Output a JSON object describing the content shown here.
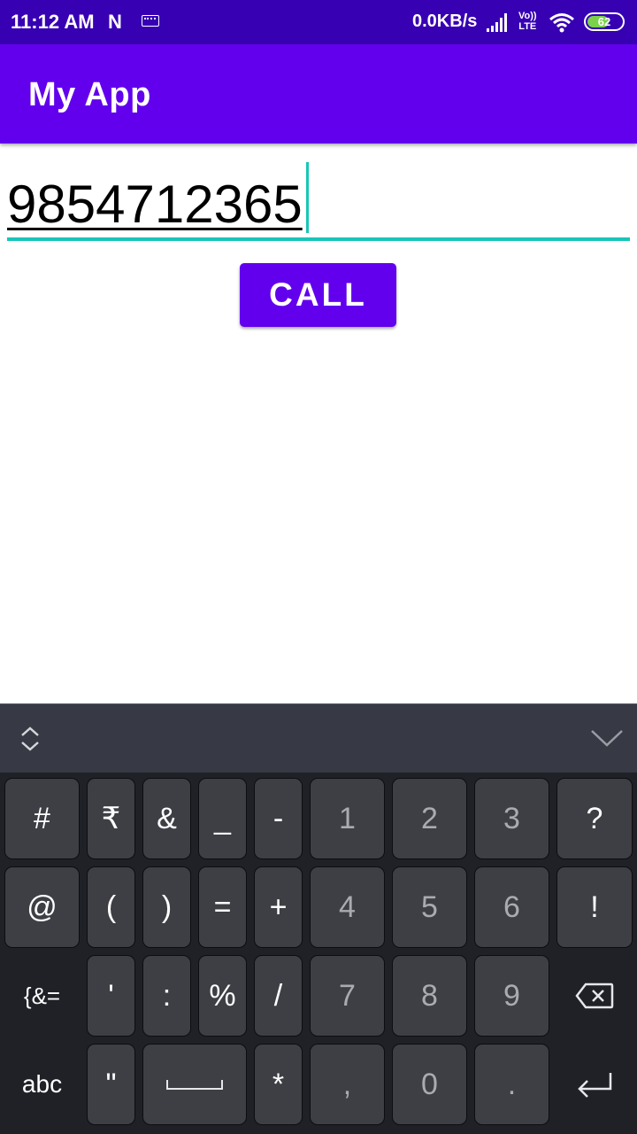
{
  "status_bar": {
    "time": "11:12 AM",
    "network_speed": "0.0KB/s",
    "lte_top": "Vo))",
    "lte_bottom": "LTE",
    "battery": "62",
    "battery_level": 0.62,
    "icons": [
      "n-icon",
      "keyboard-icon",
      "signal-icon",
      "wifi-icon",
      "battery-icon"
    ]
  },
  "app_bar": {
    "title": "My App",
    "color": "#6200ee"
  },
  "phone_input": {
    "value": "9854712365",
    "accent": "#18c5b8"
  },
  "call_button": {
    "label": "CALL"
  },
  "keyboard": {
    "row1": [
      "#",
      "₹",
      "&",
      "_",
      "-",
      "1",
      "2",
      "3",
      "?"
    ],
    "row2": [
      "@",
      "(",
      ")",
      "=",
      "+",
      "4",
      "5",
      "6",
      "!"
    ],
    "row3": [
      "{&=",
      "'",
      ":",
      "%",
      "/",
      "7",
      "8",
      "9"
    ],
    "row4": [
      "abc",
      "\"",
      "*",
      ",",
      "0",
      "."
    ],
    "icons": [
      "expand-icon",
      "hide-keyboard-icon",
      "backspace-icon",
      "space-icon",
      "enter-icon"
    ]
  }
}
